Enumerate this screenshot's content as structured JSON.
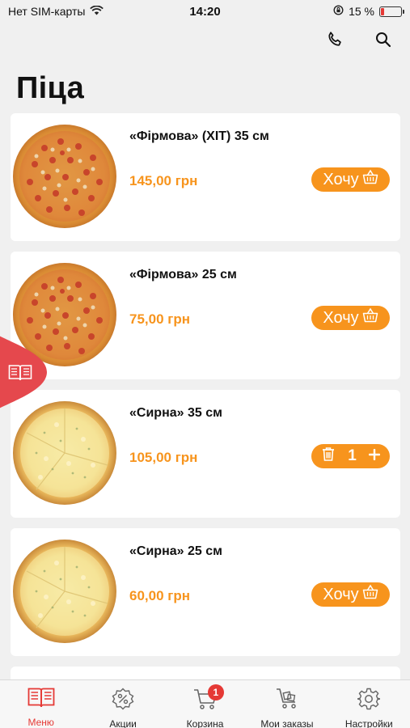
{
  "status": {
    "carrier": "Нет SIM-карты",
    "time": "14:20",
    "battery_percent": "15 %",
    "battery_level": 0.15,
    "battery_color": "#e53935"
  },
  "page": {
    "title": "Піца"
  },
  "colors": {
    "accent": "#f7941d",
    "active_tab": "#e53935"
  },
  "products": [
    {
      "name": "«Фірмова» (ХІТ) 35 см",
      "price": "145,00 грн",
      "action": "Хочу",
      "pizza": "pepperoni"
    },
    {
      "name": "«Фірмова» 25 см",
      "price": "75,00 грн",
      "action": "Хочу",
      "pizza": "pepperoni"
    },
    {
      "name": "«Сирна» 35 см",
      "price": "105,00 грн",
      "quantity": "1",
      "pizza": "cheese"
    },
    {
      "name": "«Сирна» 25 см",
      "price": "60,00 грн",
      "action": "Хочу",
      "pizza": "cheese"
    }
  ],
  "tabs": [
    {
      "label": "Меню",
      "icon": "menu-book-icon",
      "active": true
    },
    {
      "label": "Акции",
      "icon": "discount-icon"
    },
    {
      "label": "Корзина",
      "icon": "cart-icon",
      "badge": "1"
    },
    {
      "label": "Мои заказы",
      "icon": "orders-cart-icon"
    },
    {
      "label": "Настройки",
      "icon": "gear-icon"
    }
  ]
}
